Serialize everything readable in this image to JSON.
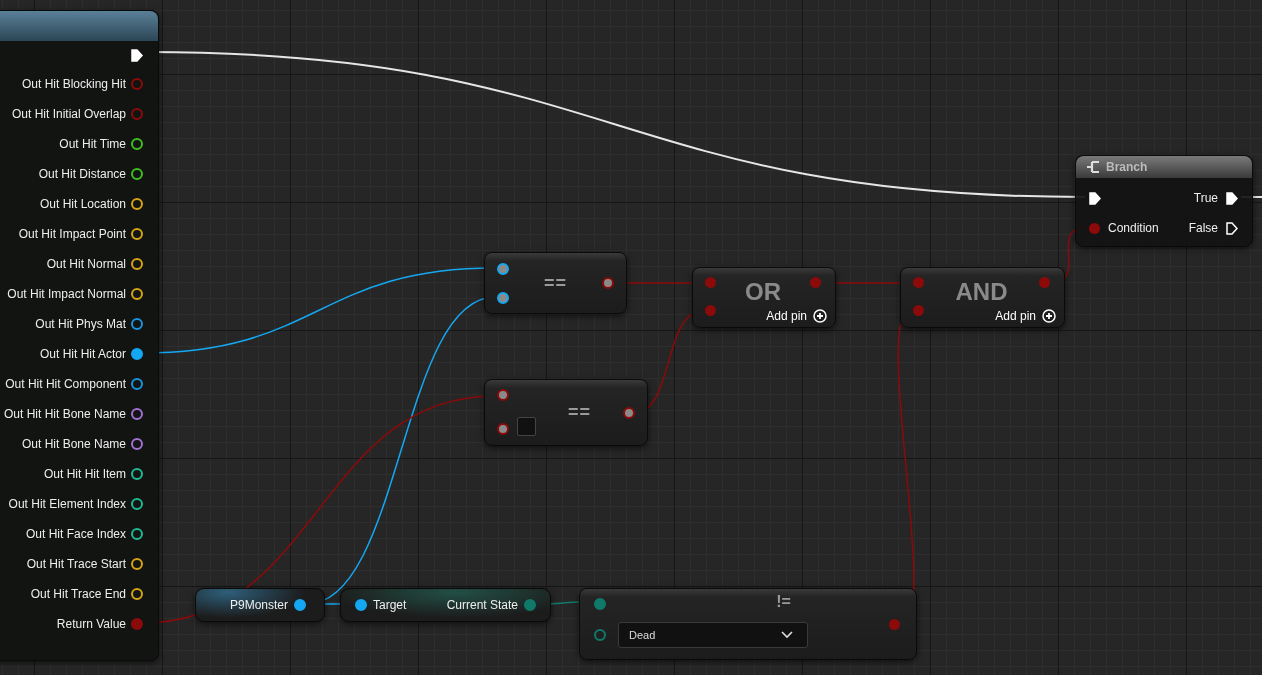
{
  "break_node": {
    "exec_connected": true,
    "pins": [
      {
        "label": "Out Hit Blocking Hit",
        "color": "#8c0a0a",
        "connected": false
      },
      {
        "label": "Out Hit Initial Overlap",
        "color": "#8c0a0a",
        "connected": false
      },
      {
        "label": "Out Hit Time",
        "color": "#3fbf1f",
        "connected": false
      },
      {
        "label": "Out Hit Distance",
        "color": "#3fbf1f",
        "connected": false
      },
      {
        "label": "Out Hit Location",
        "color": "#d6a315",
        "connected": false
      },
      {
        "label": "Out Hit Impact Point",
        "color": "#d6a315",
        "connected": false
      },
      {
        "label": "Out Hit Normal",
        "color": "#d6a315",
        "connected": false
      },
      {
        "label": "Out Hit Impact Normal",
        "color": "#d6a315",
        "connected": false
      },
      {
        "label": "Out Hit Phys Mat",
        "color": "#1b92dc",
        "connected": false
      },
      {
        "label": "Out Hit Hit Actor",
        "color": "#14a8f2",
        "connected": true
      },
      {
        "label": "Out Hit Hit Component",
        "color": "#1b92dc",
        "connected": false
      },
      {
        "label": "Out Hit Hit Bone Name",
        "color": "#a36fd6",
        "connected": false
      },
      {
        "label": "Out Hit Bone Name",
        "color": "#a36fd6",
        "connected": false
      },
      {
        "label": "Out Hit Hit Item",
        "color": "#1fb895",
        "connected": false
      },
      {
        "label": "Out Hit Element Index",
        "color": "#1fb895",
        "connected": false
      },
      {
        "label": "Out Hit Face Index",
        "color": "#1fb895",
        "connected": false
      },
      {
        "label": "Out Hit Trace Start",
        "color": "#d6a315",
        "connected": false
      },
      {
        "label": "Out Hit Trace End",
        "color": "#d6a315",
        "connected": false
      },
      {
        "label": "Return Value",
        "color": "#8c0a0a",
        "connected": true
      }
    ]
  },
  "compare_nodes": [
    {
      "symbol": "==",
      "kind": "object"
    },
    {
      "symbol": "==",
      "kind": "literal"
    }
  ],
  "logic_nodes": [
    {
      "title": "OR",
      "add_pin": "Add pin"
    },
    {
      "title": "AND",
      "add_pin": "Add pin"
    }
  ],
  "branch": {
    "title": "Branch",
    "condition": "Condition",
    "true_label": "True",
    "false_label": "False",
    "true_connected": true,
    "false_connected": false
  },
  "variable": {
    "label": "P9Monster"
  },
  "getter": {
    "input": "Target",
    "output": "Current State"
  },
  "not_equal": {
    "symbol": "!=",
    "value": "Dead"
  }
}
